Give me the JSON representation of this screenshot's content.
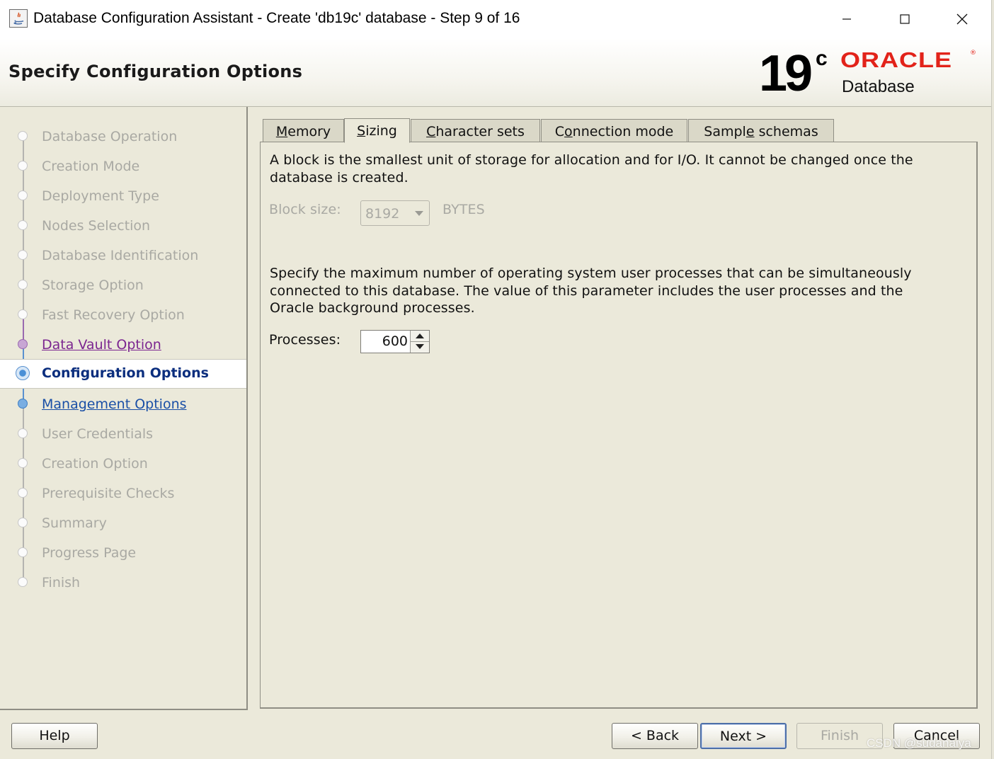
{
  "window": {
    "title": "Database Configuration Assistant - Create 'db19c' database - Step 9 of 16",
    "minimize_label": "minimize",
    "maximize_label": "maximize",
    "close_label": "close"
  },
  "header": {
    "title": "Specify Configuration Options",
    "logo_version": "19",
    "logo_sup": "c",
    "logo_brand": "ORACLE",
    "logo_product": "Database"
  },
  "sidebar": {
    "steps": [
      {
        "label": "Database Operation",
        "state": "disabled"
      },
      {
        "label": "Creation Mode",
        "state": "disabled"
      },
      {
        "label": "Deployment Type",
        "state": "disabled"
      },
      {
        "label": "Nodes Selection",
        "state": "disabled"
      },
      {
        "label": "Database Identification",
        "state": "disabled"
      },
      {
        "label": "Storage Option",
        "state": "disabled"
      },
      {
        "label": "Fast Recovery Option",
        "state": "disabled"
      },
      {
        "label": "Data Vault Option",
        "state": "visited"
      },
      {
        "label": "Configuration Options",
        "state": "current"
      },
      {
        "label": "Management Options",
        "state": "next"
      },
      {
        "label": "User Credentials",
        "state": "disabled"
      },
      {
        "label": "Creation Option",
        "state": "disabled"
      },
      {
        "label": "Prerequisite Checks",
        "state": "disabled"
      },
      {
        "label": "Summary",
        "state": "disabled"
      },
      {
        "label": "Progress Page",
        "state": "disabled"
      },
      {
        "label": "Finish",
        "state": "disabled"
      }
    ]
  },
  "tabs": [
    {
      "label": "Memory",
      "mnemonic": "M",
      "rest": "emory",
      "active": false
    },
    {
      "label": "Sizing",
      "mnemonic": "S",
      "rest": "izing",
      "active": true
    },
    {
      "label": "Character sets",
      "mnemonic": "C",
      "rest": "haracter sets",
      "active": false
    },
    {
      "label": "Connection mode",
      "pre": "C",
      "mnemonic": "o",
      "rest": "nnection mode",
      "active": false
    },
    {
      "label": "Sample schemas",
      "pre": "Sampl",
      "mnemonic": "e",
      "rest": " schemas",
      "active": false
    }
  ],
  "sizing": {
    "block_desc_line1": "A block is the smallest unit of storage for allocation and for I/O. It cannot be changed once the",
    "block_desc_line2": "database is created.",
    "block_size_label": "Block size:",
    "block_size_value": "8192",
    "block_size_unit": "BYTES",
    "processes_desc_line1": "Specify the maximum number of operating system user processes that can be simultaneously",
    "processes_desc_line2": "connected to this database. The value of this parameter includes the user processes and the",
    "processes_desc_line3": "Oracle background processes.",
    "processes_label": "Processes:",
    "processes_value": "600"
  },
  "buttons": {
    "help": "Help",
    "back": "< Back",
    "next": "Next >",
    "finish": "Finish",
    "cancel": "Cancel"
  },
  "watermark": "CSDN @sudanaiya",
  "colors": {
    "background": "#ebe9da",
    "oracle_red": "#e2231a",
    "current_step": "#0b2e7e",
    "visited_step": "#7b2590",
    "next_step": "#1a4fa6"
  }
}
